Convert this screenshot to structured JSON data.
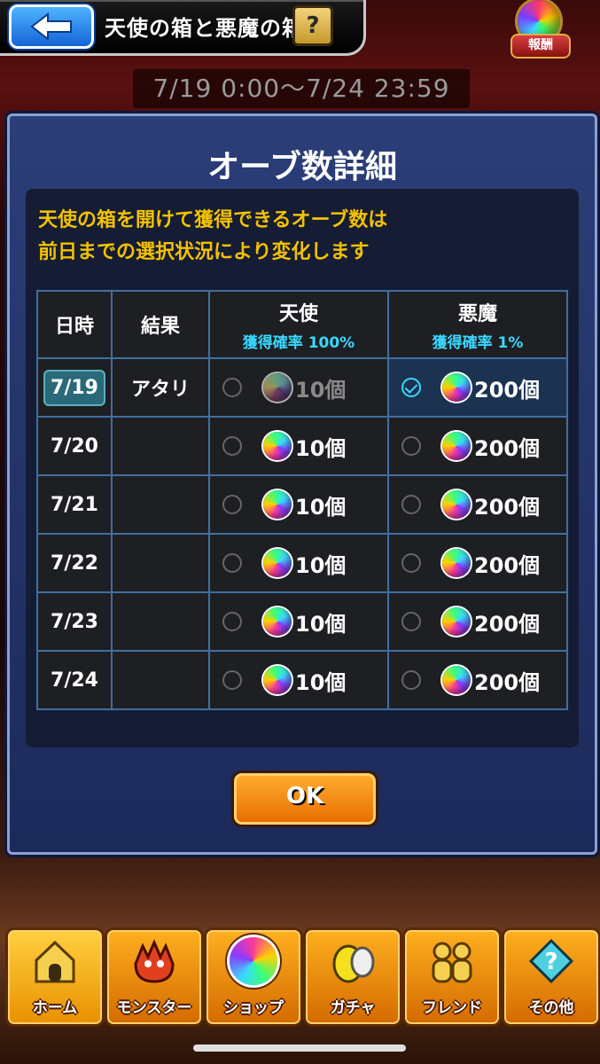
{
  "header": {
    "title": "天使の箱と悪魔の箱",
    "help_label": "?",
    "reward_label": "報酬",
    "period": "7/19 0:00〜7/24 23:59"
  },
  "modal": {
    "title": "オーブ数詳細",
    "description_line1": "天使の箱を開けて獲得できるオーブ数は",
    "description_line2": "前日までの選択状況により変化します",
    "table": {
      "headers": {
        "date": "日時",
        "result": "結果",
        "angel": "天使",
        "angel_rate": "獲得確率 100%",
        "devil": "悪魔",
        "devil_rate": "獲得確率 1%"
      },
      "rows": [
        {
          "date": "7/19",
          "result": "アタリ",
          "angel": "10個",
          "devil": "200個"
        },
        {
          "date": "7/20",
          "result": "",
          "angel": "10個",
          "devil": "200個"
        },
        {
          "date": "7/21",
          "result": "",
          "angel": "10個",
          "devil": "200個"
        },
        {
          "date": "7/22",
          "result": "",
          "angel": "10個",
          "devil": "200個"
        },
        {
          "date": "7/23",
          "result": "",
          "angel": "10個",
          "devil": "200個"
        },
        {
          "date": "7/24",
          "result": "",
          "angel": "10個",
          "devil": "200個"
        }
      ]
    },
    "ok_label": "OK"
  },
  "nav": {
    "home": "ホーム",
    "monster": "モンスター",
    "shop": "ショップ",
    "gacha": "ガチャ",
    "friend": "フレンド",
    "other": "その他"
  },
  "colors": {
    "accent_orange": "#e86a00",
    "text_yellow": "#f2c200",
    "rate_cyan": "#3ad8ff",
    "modal_blue": "#2b3e78"
  }
}
